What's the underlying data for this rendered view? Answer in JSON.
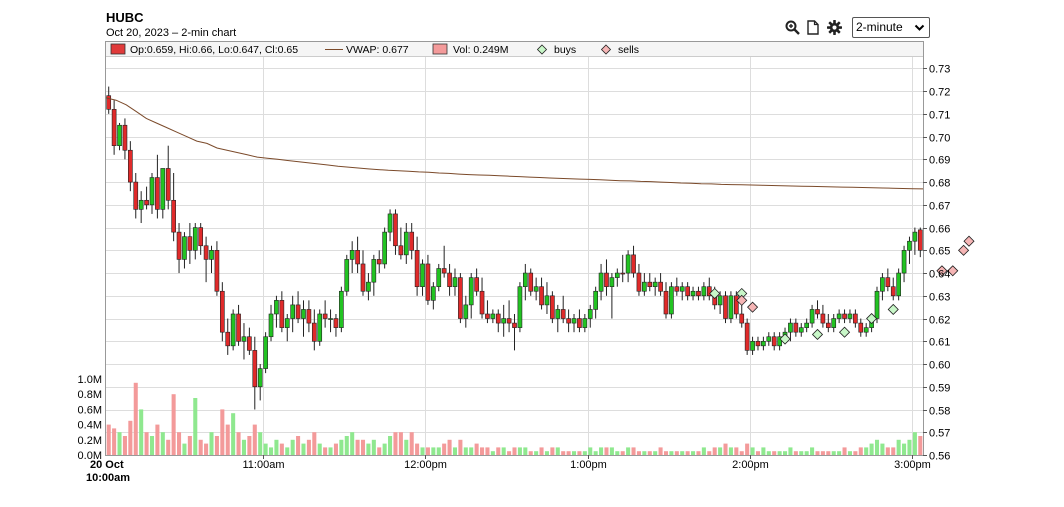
{
  "header": {
    "ticker": "HUBC",
    "subtitle": "Oct 20, 2023 – 2-min chart",
    "interval_value": "2-minute"
  },
  "icons": [
    "zoom-in-icon",
    "document-icon",
    "gear-icon"
  ],
  "legend": {
    "ohlc": "Op:0.659, Hi:0.66, Lo:0.647, Cl:0.65",
    "vwap": "VWAP: 0.677",
    "vol": "Vol: 0.249M",
    "buys": "buys",
    "sells": "sells"
  },
  "colors": {
    "up": "#22c322",
    "down": "#e02a2a",
    "vol_up": "#8fe88f",
    "vol_down": "#f39a9a",
    "vwap": "#7b4a2a",
    "grid": "#dddddd",
    "marker_buy": "#c8f7c8",
    "marker_sell": "#f5b5b5"
  },
  "chart_data": {
    "type": "candlestick",
    "date_label": "20 Oct",
    "start_time_label": "10:00am",
    "x_tick_labels": [
      "11:00am",
      "12:00pm",
      "1:00pm",
      "2:00pm",
      "3:00pm"
    ],
    "price_ticks": [
      "0.73",
      "0.72",
      "0.71",
      "0.70",
      "0.69",
      "0.68",
      "0.67",
      "0.66",
      "0.65",
      "0.64",
      "0.63",
      "0.62",
      "0.61",
      "0.60",
      "0.59",
      "0.58",
      "0.57",
      "0.56"
    ],
    "volume_ticks": [
      "1.0M",
      "0.8M",
      "0.6M",
      "0.4M",
      "0.2M",
      "0.0M"
    ],
    "price_range": [
      0.56,
      0.735
    ],
    "volume_range": [
      0,
      1.0
    ],
    "bars": [
      [
        0.718,
        0.722,
        0.71,
        0.712,
        0.4,
        "d"
      ],
      [
        0.712,
        0.716,
        0.692,
        0.696,
        0.35,
        "d"
      ],
      [
        0.696,
        0.706,
        0.694,
        0.705,
        0.3,
        "u"
      ],
      [
        0.705,
        0.708,
        0.69,
        0.694,
        0.25,
        "d"
      ],
      [
        0.694,
        0.698,
        0.676,
        0.68,
        0.45,
        "d"
      ],
      [
        0.68,
        0.684,
        0.664,
        0.668,
        0.95,
        "d"
      ],
      [
        0.668,
        0.676,
        0.662,
        0.672,
        0.6,
        "u"
      ],
      [
        0.672,
        0.678,
        0.668,
        0.67,
        0.3,
        "d"
      ],
      [
        0.67,
        0.684,
        0.666,
        0.682,
        0.25,
        "u"
      ],
      [
        0.682,
        0.692,
        0.664,
        0.668,
        0.4,
        "d"
      ],
      [
        0.668,
        0.686,
        0.664,
        0.686,
        0.3,
        "u"
      ],
      [
        0.686,
        0.696,
        0.668,
        0.672,
        0.2,
        "d"
      ],
      [
        0.672,
        0.684,
        0.654,
        0.658,
        0.8,
        "d"
      ],
      [
        0.658,
        0.662,
        0.64,
        0.646,
        0.3,
        "d"
      ],
      [
        0.646,
        0.658,
        0.642,
        0.656,
        0.15,
        "u"
      ],
      [
        0.656,
        0.662,
        0.644,
        0.65,
        0.25,
        "d"
      ],
      [
        0.65,
        0.662,
        0.646,
        0.66,
        0.75,
        "u"
      ],
      [
        0.66,
        0.662,
        0.648,
        0.652,
        0.2,
        "d"
      ],
      [
        0.652,
        0.656,
        0.636,
        0.646,
        0.15,
        "d"
      ],
      [
        0.646,
        0.652,
        0.64,
        0.65,
        0.3,
        "u"
      ],
      [
        0.65,
        0.654,
        0.63,
        0.632,
        0.25,
        "d"
      ],
      [
        0.632,
        0.636,
        0.61,
        0.614,
        0.6,
        "d"
      ],
      [
        0.614,
        0.62,
        0.604,
        0.608,
        0.4,
        "d"
      ],
      [
        0.608,
        0.624,
        0.606,
        0.622,
        0.55,
        "u"
      ],
      [
        0.622,
        0.626,
        0.608,
        0.61,
        0.3,
        "d"
      ],
      [
        0.61,
        0.618,
        0.602,
        0.612,
        0.2,
        "u"
      ],
      [
        0.612,
        0.616,
        0.604,
        0.606,
        0.25,
        "d"
      ],
      [
        0.606,
        0.612,
        0.58,
        0.59,
        0.4,
        "d"
      ],
      [
        0.59,
        0.6,
        0.584,
        0.598,
        0.3,
        "u"
      ],
      [
        0.598,
        0.614,
        0.596,
        0.612,
        0.15,
        "u"
      ],
      [
        0.612,
        0.626,
        0.61,
        0.622,
        0.1,
        "u"
      ],
      [
        0.622,
        0.63,
        0.616,
        0.628,
        0.2,
        "u"
      ],
      [
        0.628,
        0.632,
        0.614,
        0.616,
        0.15,
        "d"
      ],
      [
        0.616,
        0.622,
        0.61,
        0.62,
        0.1,
        "u"
      ],
      [
        0.62,
        0.63,
        0.614,
        0.626,
        0.2,
        "u"
      ],
      [
        0.626,
        0.632,
        0.618,
        0.62,
        0.25,
        "d"
      ],
      [
        0.62,
        0.628,
        0.612,
        0.624,
        0.15,
        "u"
      ],
      [
        0.624,
        0.628,
        0.614,
        0.618,
        0.2,
        "d"
      ],
      [
        0.618,
        0.624,
        0.606,
        0.61,
        0.3,
        "d"
      ],
      [
        0.61,
        0.624,
        0.608,
        0.622,
        0.15,
        "u"
      ],
      [
        0.622,
        0.628,
        0.616,
        0.62,
        0.1,
        "d"
      ],
      [
        0.62,
        0.624,
        0.614,
        0.62,
        0.1,
        "u"
      ],
      [
        0.62,
        0.622,
        0.612,
        0.616,
        0.15,
        "d"
      ],
      [
        0.616,
        0.634,
        0.614,
        0.632,
        0.2,
        "u"
      ],
      [
        0.632,
        0.648,
        0.63,
        0.646,
        0.25,
        "u"
      ],
      [
        0.646,
        0.654,
        0.64,
        0.65,
        0.3,
        "u"
      ],
      [
        0.65,
        0.656,
        0.64,
        0.644,
        0.2,
        "d"
      ],
      [
        0.644,
        0.65,
        0.63,
        0.632,
        0.2,
        "d"
      ],
      [
        0.632,
        0.64,
        0.628,
        0.636,
        0.15,
        "u"
      ],
      [
        0.636,
        0.648,
        0.63,
        0.646,
        0.2,
        "u"
      ],
      [
        0.646,
        0.65,
        0.64,
        0.644,
        0.1,
        "d"
      ],
      [
        0.644,
        0.66,
        0.642,
        0.658,
        0.15,
        "u"
      ],
      [
        0.658,
        0.668,
        0.654,
        0.666,
        0.25,
        "u"
      ],
      [
        0.666,
        0.668,
        0.648,
        0.652,
        0.3,
        "d"
      ],
      [
        0.652,
        0.66,
        0.646,
        0.648,
        0.3,
        "d"
      ],
      [
        0.648,
        0.662,
        0.644,
        0.658,
        0.2,
        "u"
      ],
      [
        0.658,
        0.662,
        0.646,
        0.65,
        0.3,
        "d"
      ],
      [
        0.65,
        0.656,
        0.63,
        0.634,
        0.15,
        "d"
      ],
      [
        0.634,
        0.646,
        0.63,
        0.644,
        0.1,
        "u"
      ],
      [
        0.644,
        0.648,
        0.626,
        0.628,
        0.1,
        "d"
      ],
      [
        0.628,
        0.636,
        0.624,
        0.634,
        0.1,
        "u"
      ],
      [
        0.634,
        0.644,
        0.632,
        0.642,
        0.1,
        "u"
      ],
      [
        0.642,
        0.652,
        0.638,
        0.64,
        0.15,
        "d"
      ],
      [
        0.64,
        0.644,
        0.63,
        0.634,
        0.2,
        "d"
      ],
      [
        0.634,
        0.642,
        0.63,
        0.638,
        0.1,
        "u"
      ],
      [
        0.638,
        0.64,
        0.618,
        0.62,
        0.2,
        "d"
      ],
      [
        0.62,
        0.63,
        0.616,
        0.626,
        0.1,
        "u"
      ],
      [
        0.626,
        0.64,
        0.62,
        0.638,
        0.1,
        "u"
      ],
      [
        0.638,
        0.642,
        0.63,
        0.632,
        0.15,
        "d"
      ],
      [
        0.632,
        0.638,
        0.62,
        0.622,
        0.1,
        "d"
      ],
      [
        0.622,
        0.628,
        0.618,
        0.62,
        0.1,
        "d"
      ],
      [
        0.62,
        0.624,
        0.618,
        0.622,
        0.05,
        "u"
      ],
      [
        0.622,
        0.624,
        0.614,
        0.618,
        0.1,
        "d"
      ],
      [
        0.618,
        0.626,
        0.612,
        0.62,
        0.1,
        "u"
      ],
      [
        0.62,
        0.628,
        0.614,
        0.618,
        0.05,
        "d"
      ],
      [
        0.618,
        0.622,
        0.606,
        0.616,
        0.1,
        "d"
      ],
      [
        0.616,
        0.636,
        0.614,
        0.634,
        0.1,
        "u"
      ],
      [
        0.634,
        0.644,
        0.628,
        0.64,
        0.1,
        "u"
      ],
      [
        0.64,
        0.642,
        0.63,
        0.632,
        0.05,
        "d"
      ],
      [
        0.632,
        0.638,
        0.628,
        0.634,
        0.05,
        "u"
      ],
      [
        0.634,
        0.638,
        0.624,
        0.626,
        0.1,
        "d"
      ],
      [
        0.626,
        0.636,
        0.622,
        0.63,
        0.05,
        "u"
      ],
      [
        0.63,
        0.632,
        0.618,
        0.62,
        0.1,
        "d"
      ],
      [
        0.62,
        0.626,
        0.614,
        0.624,
        0.1,
        "u"
      ],
      [
        0.624,
        0.63,
        0.618,
        0.62,
        0.05,
        "d"
      ],
      [
        0.62,
        0.624,
        0.614,
        0.618,
        0.05,
        "d"
      ],
      [
        0.618,
        0.622,
        0.614,
        0.62,
        0.05,
        "u"
      ],
      [
        0.62,
        0.624,
        0.614,
        0.616,
        0.05,
        "d"
      ],
      [
        0.616,
        0.622,
        0.614,
        0.62,
        0.05,
        "u"
      ],
      [
        0.62,
        0.626,
        0.616,
        0.624,
        0.1,
        "u"
      ],
      [
        0.624,
        0.634,
        0.62,
        0.632,
        0.05,
        "u"
      ],
      [
        0.632,
        0.644,
        0.628,
        0.64,
        0.1,
        "u"
      ],
      [
        0.64,
        0.646,
        0.63,
        0.634,
        0.1,
        "d"
      ],
      [
        0.634,
        0.64,
        0.62,
        0.638,
        0.1,
        "u"
      ],
      [
        0.638,
        0.642,
        0.634,
        0.64,
        0.05,
        "u"
      ],
      [
        0.64,
        0.648,
        0.636,
        0.64,
        0.05,
        "d"
      ],
      [
        0.64,
        0.65,
        0.636,
        0.648,
        0.1,
        "u"
      ],
      [
        0.648,
        0.652,
        0.638,
        0.64,
        0.1,
        "d"
      ],
      [
        0.64,
        0.644,
        0.63,
        0.632,
        0.05,
        "d"
      ],
      [
        0.632,
        0.64,
        0.63,
        0.636,
        0.05,
        "u"
      ],
      [
        0.636,
        0.64,
        0.632,
        0.634,
        0.05,
        "d"
      ],
      [
        0.634,
        0.638,
        0.63,
        0.636,
        0.05,
        "u"
      ],
      [
        0.636,
        0.64,
        0.63,
        0.632,
        0.1,
        "d"
      ],
      [
        0.632,
        0.636,
        0.62,
        0.622,
        0.05,
        "d"
      ],
      [
        0.622,
        0.636,
        0.62,
        0.634,
        0.05,
        "u"
      ],
      [
        0.634,
        0.638,
        0.63,
        0.632,
        0.05,
        "d"
      ],
      [
        0.632,
        0.636,
        0.628,
        0.634,
        0.05,
        "u"
      ],
      [
        0.634,
        0.636,
        0.628,
        0.63,
        0.05,
        "d"
      ],
      [
        0.63,
        0.634,
        0.628,
        0.632,
        0.05,
        "u"
      ],
      [
        0.632,
        0.634,
        0.628,
        0.63,
        0.05,
        "d"
      ],
      [
        0.63,
        0.636,
        0.628,
        0.634,
        0.1,
        "u"
      ],
      [
        0.634,
        0.638,
        0.628,
        0.63,
        0.05,
        "d"
      ],
      [
        0.63,
        0.634,
        0.624,
        0.626,
        0.1,
        "d"
      ],
      [
        0.626,
        0.632,
        0.622,
        0.63,
        0.1,
        "u"
      ],
      [
        0.63,
        0.632,
        0.618,
        0.62,
        0.15,
        "d"
      ],
      [
        0.62,
        0.632,
        0.618,
        0.63,
        0.1,
        "u"
      ],
      [
        0.63,
        0.632,
        0.62,
        0.622,
        0.1,
        "d"
      ],
      [
        0.622,
        0.626,
        0.616,
        0.618,
        0.05,
        "d"
      ],
      [
        0.618,
        0.62,
        0.604,
        0.606,
        0.15,
        "d"
      ],
      [
        0.606,
        0.612,
        0.604,
        0.61,
        0.1,
        "u"
      ],
      [
        0.61,
        0.612,
        0.606,
        0.608,
        0.05,
        "d"
      ],
      [
        0.608,
        0.612,
        0.606,
        0.61,
        0.1,
        "u"
      ],
      [
        0.61,
        0.614,
        0.608,
        0.612,
        0.05,
        "u"
      ],
      [
        0.612,
        0.614,
        0.606,
        0.608,
        0.05,
        "d"
      ],
      [
        0.608,
        0.614,
        0.606,
        0.612,
        0.05,
        "u"
      ],
      [
        0.612,
        0.616,
        0.61,
        0.614,
        0.05,
        "u"
      ],
      [
        0.614,
        0.62,
        0.61,
        0.618,
        0.1,
        "u"
      ],
      [
        0.618,
        0.62,
        0.612,
        0.614,
        0.05,
        "d"
      ],
      [
        0.614,
        0.618,
        0.612,
        0.616,
        0.05,
        "u"
      ],
      [
        0.616,
        0.62,
        0.614,
        0.618,
        0.05,
        "u"
      ],
      [
        0.618,
        0.626,
        0.616,
        0.624,
        0.1,
        "u"
      ],
      [
        0.624,
        0.628,
        0.62,
        0.622,
        0.05,
        "d"
      ],
      [
        0.622,
        0.626,
        0.616,
        0.618,
        0.05,
        "d"
      ],
      [
        0.618,
        0.622,
        0.614,
        0.616,
        0.05,
        "d"
      ],
      [
        0.616,
        0.622,
        0.614,
        0.62,
        0.05,
        "u"
      ],
      [
        0.62,
        0.624,
        0.618,
        0.622,
        0.05,
        "u"
      ],
      [
        0.622,
        0.624,
        0.618,
        0.62,
        0.1,
        "d"
      ],
      [
        0.62,
        0.624,
        0.618,
        0.622,
        0.05,
        "u"
      ],
      [
        0.622,
        0.624,
        0.616,
        0.618,
        0.05,
        "d"
      ],
      [
        0.618,
        0.62,
        0.612,
        0.614,
        0.1,
        "d"
      ],
      [
        0.614,
        0.618,
        0.612,
        0.616,
        0.1,
        "u"
      ],
      [
        0.616,
        0.622,
        0.614,
        0.62,
        0.15,
        "u"
      ],
      [
        0.62,
        0.634,
        0.618,
        0.632,
        0.2,
        "u"
      ],
      [
        0.632,
        0.64,
        0.628,
        0.638,
        0.15,
        "u"
      ],
      [
        0.638,
        0.642,
        0.632,
        0.634,
        0.1,
        "d"
      ],
      [
        0.634,
        0.638,
        0.628,
        0.63,
        0.1,
        "d"
      ],
      [
        0.63,
        0.642,
        0.628,
        0.64,
        0.2,
        "u"
      ],
      [
        0.64,
        0.652,
        0.636,
        0.65,
        0.15,
        "u"
      ],
      [
        0.65,
        0.656,
        0.644,
        0.654,
        0.2,
        "u"
      ],
      [
        0.654,
        0.66,
        0.648,
        0.658,
        0.3,
        "u"
      ],
      [
        0.659,
        0.66,
        0.647,
        0.65,
        0.25,
        "d"
      ]
    ],
    "vwap": [
      0.717,
      0.716,
      0.714,
      0.711,
      0.708,
      0.706,
      0.704,
      0.702,
      0.7,
      0.698,
      0.697,
      0.695,
      0.694,
      0.693,
      0.692,
      0.691,
      0.6905,
      0.69,
      0.6895,
      0.689,
      0.6885,
      0.688,
      0.6875,
      0.687,
      0.6866,
      0.6862,
      0.6858,
      0.6855,
      0.6852,
      0.685,
      0.6848,
      0.6845,
      0.6843,
      0.684,
      0.6838,
      0.6835,
      0.6833,
      0.6831,
      0.683,
      0.6828,
      0.6826,
      0.6824,
      0.6822,
      0.682,
      0.6818,
      0.6816,
      0.6815,
      0.6813,
      0.6812,
      0.681,
      0.6808,
      0.6806,
      0.6805,
      0.6803,
      0.6802,
      0.68,
      0.6798,
      0.6796,
      0.6795,
      0.6793,
      0.6792,
      0.679,
      0.6789,
      0.6788,
      0.6787,
      0.6786,
      0.6785,
      0.6784,
      0.6783,
      0.6782,
      0.6781,
      0.678,
      0.6779,
      0.6778,
      0.6777,
      0.6776,
      0.6775,
      0.6774,
      0.6773,
      0.6772,
      0.6771,
      0.677
    ],
    "buys": [
      [
        112,
        0.631
      ],
      [
        117,
        0.631
      ],
      [
        125,
        0.611
      ],
      [
        131,
        0.613
      ],
      [
        136,
        0.614
      ],
      [
        141,
        0.62
      ],
      [
        145,
        0.624
      ]
    ],
    "sells": [
      [
        117,
        0.628
      ],
      [
        119,
        0.625
      ],
      [
        154,
        0.641
      ],
      [
        156,
        0.641
      ],
      [
        158,
        0.65
      ],
      [
        159,
        0.654
      ]
    ]
  }
}
